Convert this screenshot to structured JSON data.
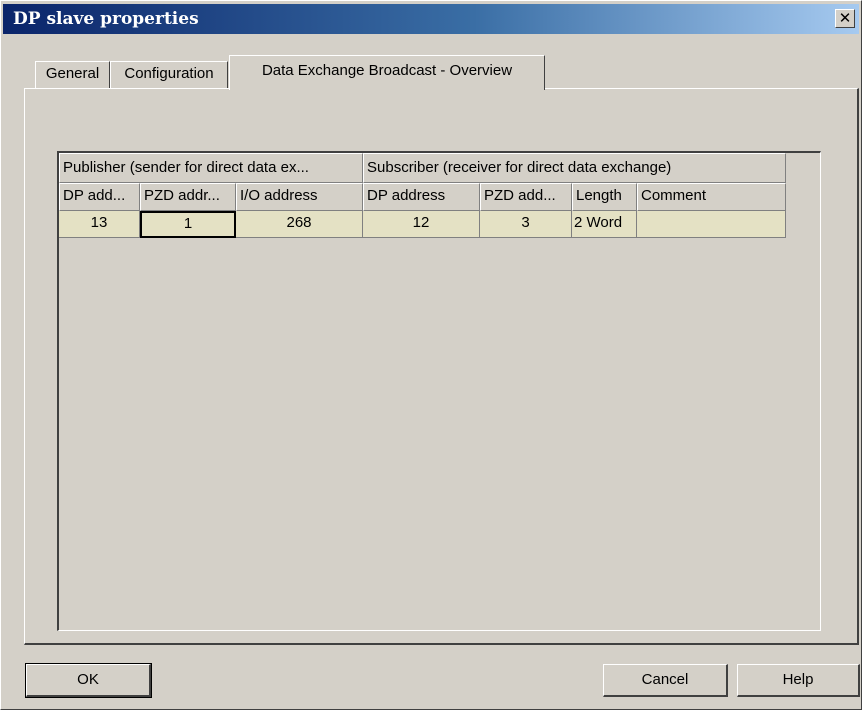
{
  "window": {
    "title": "DP slave properties",
    "close_glyph": "✕"
  },
  "tabs": [
    {
      "label": "General"
    },
    {
      "label": "Configuration"
    },
    {
      "label": "Data Exchange Broadcast - Overview"
    }
  ],
  "grid": {
    "group_headers": {
      "publisher": "Publisher (sender for direct data ex...",
      "subscriber": "Subscriber (receiver for direct data exchange)"
    },
    "columns": [
      "DP add...",
      "PZD addr...",
      "I/O address",
      "DP address",
      "PZD add...",
      "Length",
      "Comment"
    ],
    "rows": [
      [
        "13",
        "1",
        "268",
        "12",
        "3",
        "2 Word",
        ""
      ]
    ]
  },
  "buttons": {
    "ok": "OK",
    "cancel": "Cancel",
    "help": "Help"
  }
}
